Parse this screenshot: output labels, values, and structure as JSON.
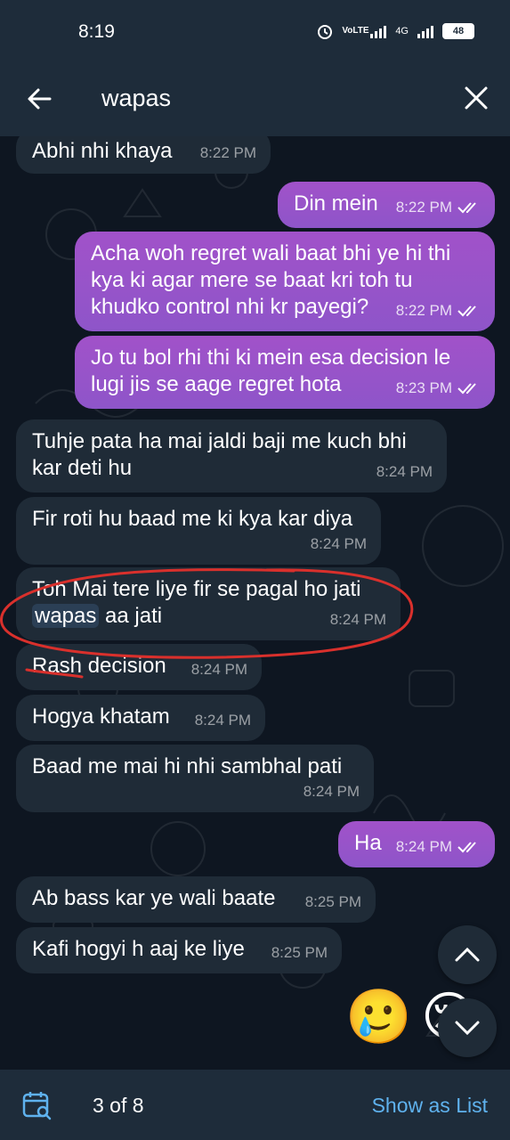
{
  "status": {
    "time": "8:19",
    "volte": "VoLTE",
    "net": "4G",
    "battery": "48"
  },
  "search": {
    "query": "wapas"
  },
  "messages": [
    {
      "text": "Abhi nhi khaya",
      "time": "8:22 PM"
    },
    {
      "text": "Din mein",
      "time": "8:22 PM"
    },
    {
      "text": "Acha woh regret wali baat bhi ye hi thi kya ki agar mere se baat kri toh tu khudko control nhi kr payegi?",
      "time": "8:22 PM"
    },
    {
      "text": "Jo tu bol rhi thi ki mein esa decision le lugi jis se aage regret hota",
      "time": "8:23 PM"
    },
    {
      "text": "Tuhje pata ha mai jaldi baji me kuch bhi kar deti hu",
      "time": "8:24 PM"
    },
    {
      "text": "Fir roti hu baad me ki kya kar diya",
      "time": "8:24 PM"
    },
    {
      "text_before": "Toh Mai tere liye fir se pagal ho jati",
      "highlight": "wapas",
      "text_after": " aa jati",
      "time": "8:24 PM"
    },
    {
      "text": "Rash decision",
      "time": "8:24 PM"
    },
    {
      "text": "Hogya khatam",
      "time": "8:24 PM"
    },
    {
      "text": "Baad me mai hi nhi sambhal pati",
      "time": "8:24 PM"
    },
    {
      "text": "Ha",
      "time": "8:24 PM"
    },
    {
      "text": "Ab bass kar ye wali baate",
      "time": "8:25 PM"
    },
    {
      "text": "Kafi hogyi h aaj ke liye",
      "time": "8:25 PM"
    }
  ],
  "stickers": {
    "emoji1": "🥲",
    "emoji2": "😢"
  },
  "bottom": {
    "counter": "3 of 8",
    "show_as_list": "Show as List"
  },
  "colors": {
    "header": "#1e2c3a",
    "background": "#0e1621",
    "incoming": "#1f2b37",
    "outgoing": "#9b59c7",
    "link": "#5fb2ee",
    "annotation": "#d9302c"
  }
}
